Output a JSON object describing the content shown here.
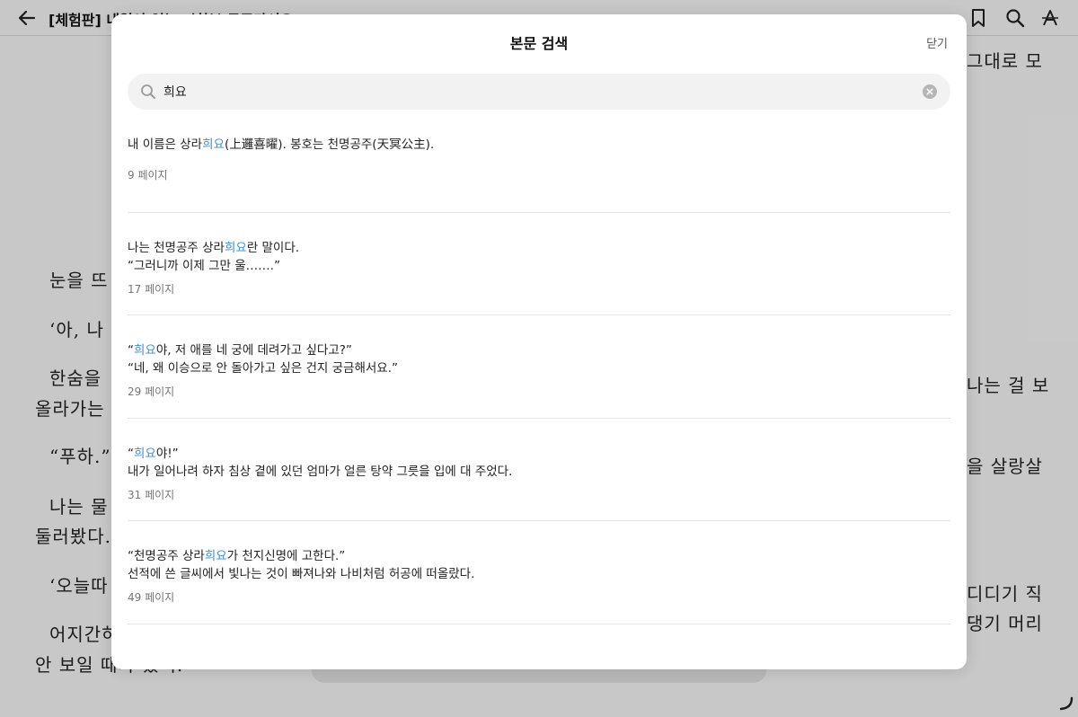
{
  "reader": {
    "book_title": "[체험판] 내일이 없는 시한부 공주라서요",
    "body_fragments": {
      "right_1": "그대로 모",
      "left_1": "눈을 뜨",
      "left_2": "‘아, 나 ",
      "left_3": "한숨을",
      "right_3": "나는 걸 보",
      "left_4": "올라가는",
      "left_5": "“푸하.”",
      "right_5": "을 살랑살",
      "left_6": "나는 물",
      "left_7": "둘러봤다.",
      "left_8": "‘오늘따",
      "right_8": "디디기 직",
      "left_9": "어지간하",
      "right_9": "댕기 머리",
      "left_10": "안 보일 때가 있어."
    }
  },
  "modal": {
    "title": "본문 검색",
    "close_label": "닫기",
    "search": {
      "value": "희요"
    },
    "results": [
      {
        "lines": [
          {
            "before": "내 이름은 상라",
            "match": "희요",
            "after": "(上邏喜曜). 봉호는 천명공주(天冥公主)."
          }
        ],
        "page": "9 페이지"
      },
      {
        "lines": [
          {
            "before": "나는 천명공주 상라",
            "match": "희요",
            "after": "란 말이다."
          },
          {
            "before": "“그러니까 이제 그만 울…….”",
            "match": "",
            "after": ""
          }
        ],
        "page": "17 페이지"
      },
      {
        "lines": [
          {
            "before": "“",
            "match": "희요",
            "after": "야, 저 애를 네 궁에 데려가고 싶다고?”"
          },
          {
            "before": "“네, 왜 이승으로 안 돌아가고 싶은 건지 궁금해서요.”",
            "match": "",
            "after": ""
          }
        ],
        "page": "29 페이지"
      },
      {
        "lines": [
          {
            "before": "“",
            "match": "희요",
            "after": "야!”"
          },
          {
            "before": "내가 일어나려 하자 침상 곁에 있던 엄마가 얼른 탕약 그릇을 입에 대 주었다.",
            "match": "",
            "after": ""
          }
        ],
        "page": "31 페이지"
      },
      {
        "lines": [
          {
            "before": "“천명공주 상라",
            "match": "희요",
            "after": "가 천지신명에 고한다.”"
          },
          {
            "before": "선적에 쓴 글씨에서 빛나는 것이 빠져나와 나비처럼 허공에 떠올랐다.",
            "match": "",
            "after": ""
          }
        ],
        "page": "49 페이지"
      }
    ]
  },
  "colors": {
    "highlight": "#3a8ee6",
    "overlay": "rgba(0,0,0,0.20)"
  },
  "icons": [
    "back-arrow-icon",
    "bookmark-icon",
    "search-icon",
    "font-settings-icon",
    "clear-icon",
    "resize-handle-icon"
  ]
}
